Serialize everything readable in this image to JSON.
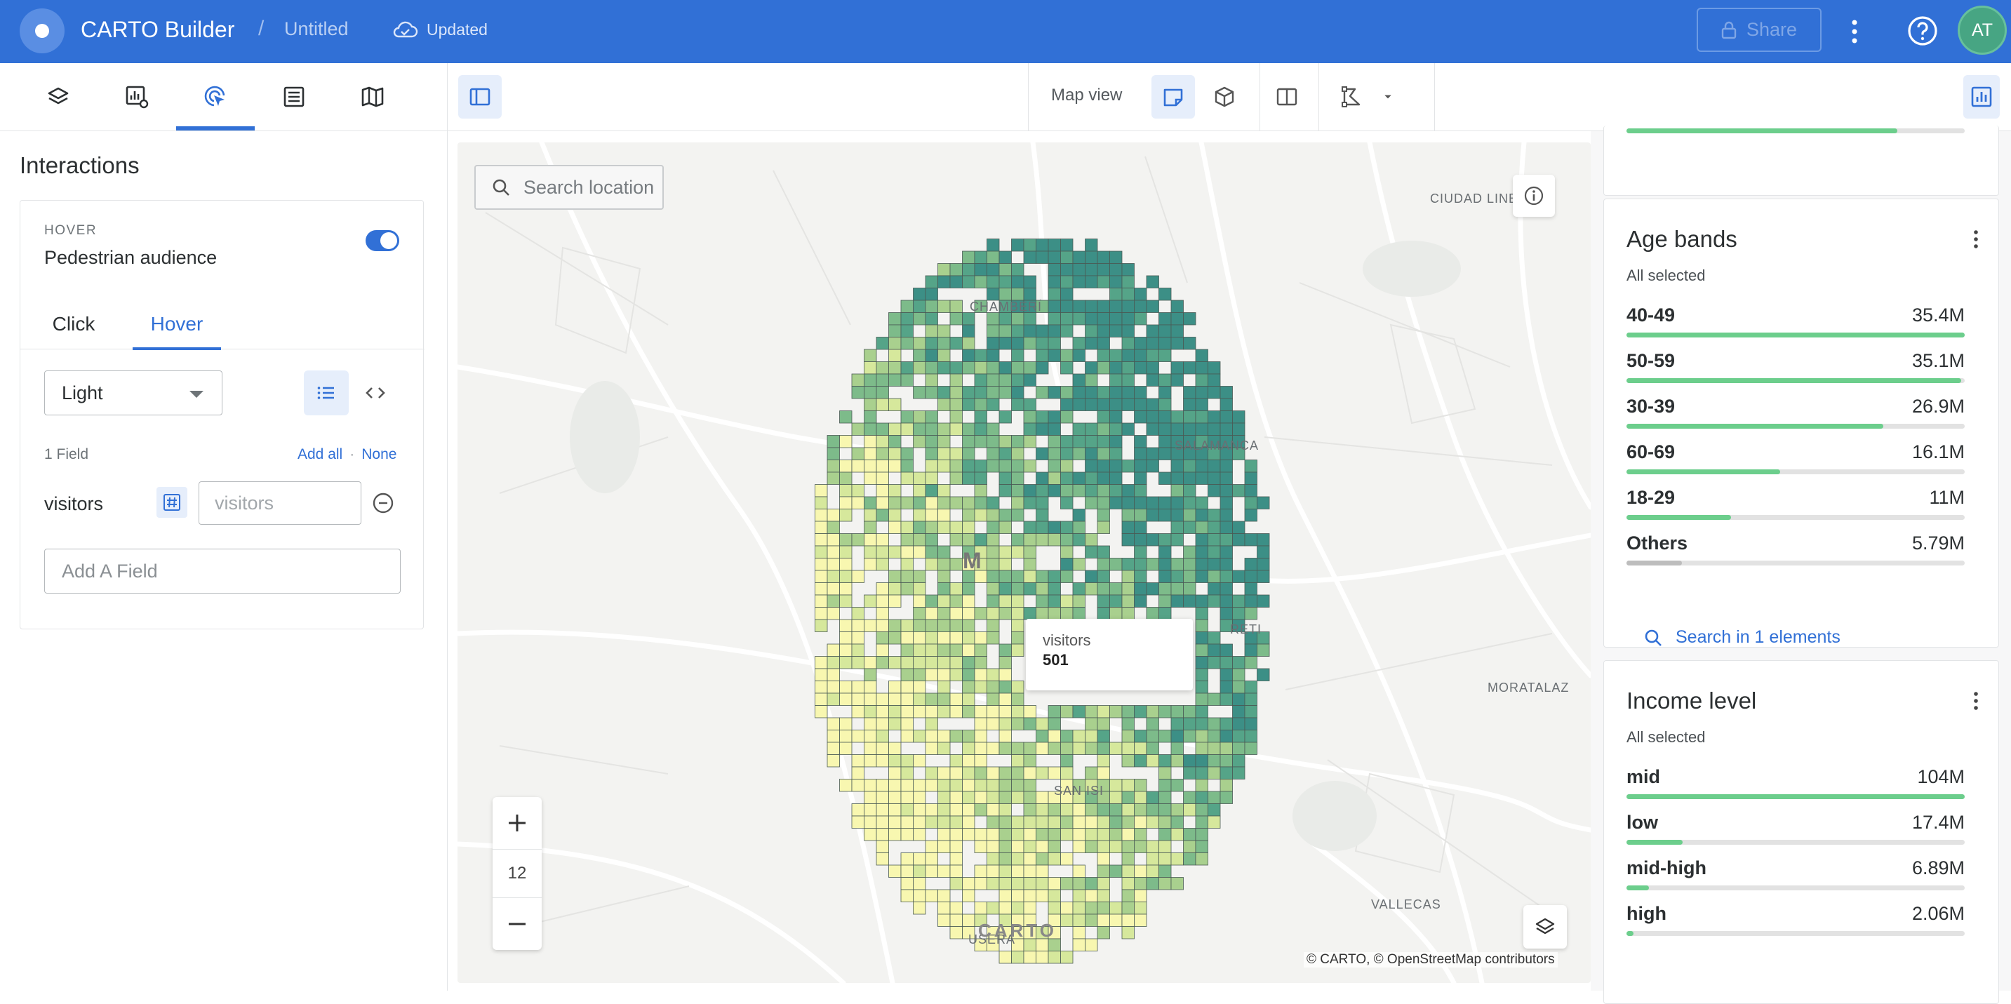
{
  "header": {
    "app_title": "CARTO Builder",
    "separator": "/",
    "map_name": "Untitled",
    "save_status": "Updated",
    "share_label": "Share",
    "avatar_initials": "AT",
    "brand_color": "#3170d6"
  },
  "left_tabs": [
    {
      "name": "layers",
      "icon": "layers-icon"
    },
    {
      "name": "widgets",
      "icon": "widget-settings-icon"
    },
    {
      "name": "interactions",
      "icon": "interactions-icon",
      "active": true
    },
    {
      "name": "sql-parameters",
      "icon": "list-icon"
    },
    {
      "name": "basemaps",
      "icon": "map-icon"
    }
  ],
  "map_toolbar": {
    "map_view_label": "Map view"
  },
  "interactions": {
    "panel_title": "Interactions",
    "mode_caption": "HOVER",
    "layer_name": "Pedestrian audience",
    "enabled": true,
    "tabs": [
      {
        "label": "Click"
      },
      {
        "label": "Hover",
        "active": true
      }
    ],
    "style_value": "Light",
    "field_count": "1 Field",
    "add_all": "Add all",
    "link_separator": "·",
    "none": "None",
    "field": {
      "name": "visitors",
      "alias_placeholder": "visitors"
    },
    "add_field_placeholder": "Add A Field"
  },
  "map": {
    "search_placeholder": "Search location",
    "zoom_level": "12",
    "attribution": "© CARTO, © OpenStreetMap contributors",
    "watermark": "CARTO",
    "tooltip": {
      "label": "visitors",
      "value": "501"
    },
    "place_labels": {
      "ciudad_lineal": "CIUDAD LINEAL",
      "moratalaz": "MORATALAZ",
      "vallecas": "VALLECAS",
      "salamanca": "SALAMANCA",
      "chamberi": "CHAMBERÍ",
      "retiro": "RETI",
      "usera": "USERA",
      "madrid": "M",
      "carabanchel": "SAN ISI"
    },
    "ramp_colors": [
      "#f8f7b0",
      "#d6e89c",
      "#a9d08e",
      "#7dbb8a",
      "#55a488",
      "#3c8f86"
    ]
  },
  "widgets": {
    "age_bands": {
      "title": "Age bands",
      "selection": "All selected",
      "items": [
        {
          "label": "40-49",
          "value": "35.4M",
          "ratio": 1.0
        },
        {
          "label": "50-59",
          "value": "35.1M",
          "ratio": 0.99
        },
        {
          "label": "30-39",
          "value": "26.9M",
          "ratio": 0.76
        },
        {
          "label": "60-69",
          "value": "16.1M",
          "ratio": 0.455
        },
        {
          "label": "18-29",
          "value": "11M",
          "ratio": 0.31
        },
        {
          "label": "Others",
          "value": "5.79M",
          "ratio": 0.164,
          "muted": true
        }
      ],
      "search_label": "Search in 1 elements"
    },
    "income_level": {
      "title": "Income level",
      "selection": "All selected",
      "items": [
        {
          "label": "mid",
          "value": "104M",
          "ratio": 1.0
        },
        {
          "label": "low",
          "value": "17.4M",
          "ratio": 0.167
        },
        {
          "label": "mid-high",
          "value": "6.89M",
          "ratio": 0.066
        },
        {
          "label": "high",
          "value": "2.06M",
          "ratio": 0.02
        }
      ]
    },
    "top_widget_ratio": 0.8
  }
}
